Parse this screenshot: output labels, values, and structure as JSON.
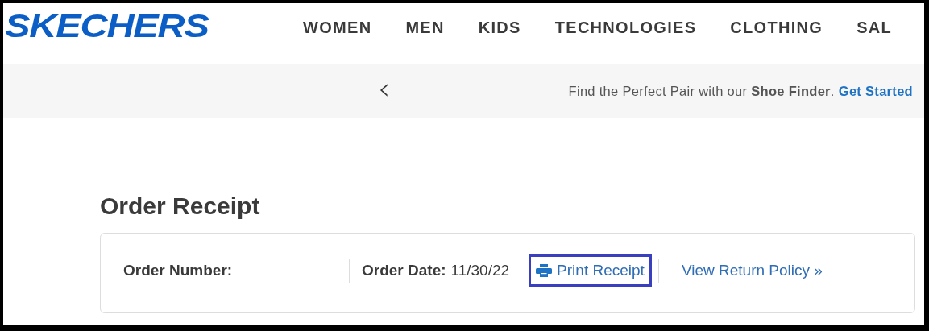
{
  "header": {
    "logo": "SKECHERS",
    "nav": [
      {
        "label": "WOMEN"
      },
      {
        "label": "MEN"
      },
      {
        "label": "KIDS"
      },
      {
        "label": "TECHNOLOGIES"
      },
      {
        "label": "CLOTHING"
      },
      {
        "label": "SAL"
      }
    ]
  },
  "promo": {
    "previous": "‹",
    "message": "Find the Perfect Pair with our **Shoe Finder**.",
    "link": "Get Started"
  },
  "page": {
    "title": "Order Receipt",
    "order": {
      "number_label": "Order Number:",
      "date_label": "Order Date:",
      "date_value": "11/30/22",
      "actions": [
        {
          "kind": "print",
          "label": "Print Receipt",
          "highlighted": true
        },
        {
          "kind": "policy",
          "label": "View Return Policy »",
          "highlighted": false
        }
      ]
    }
  }
}
